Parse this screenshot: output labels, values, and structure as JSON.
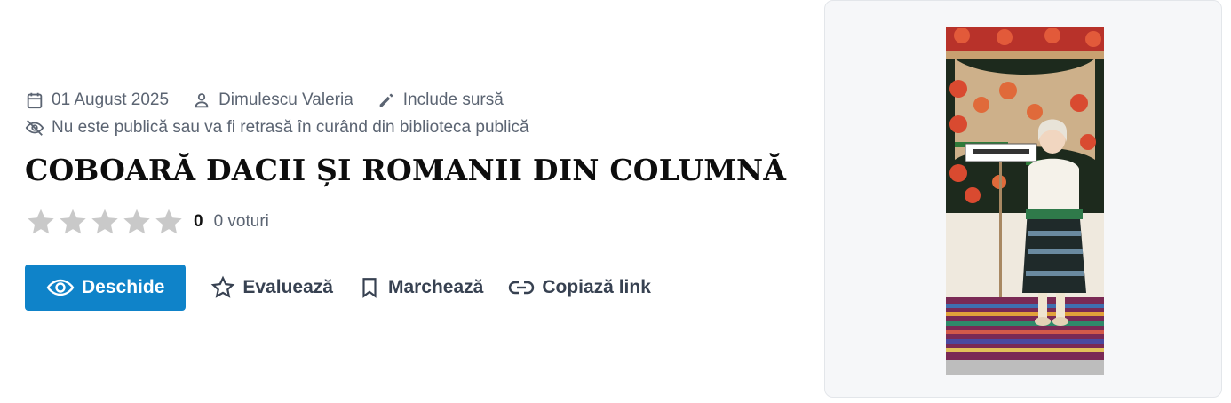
{
  "meta": {
    "date": "01 August 2025",
    "author": "Dimulescu Valeria",
    "source_note": "Include sursă",
    "visibility_note": "Nu este publică sau va fi retrasă în curând din biblioteca publică"
  },
  "title": "COBOARĂ DACII ȘI ROMANII DIN COLUMNĂ",
  "rating": {
    "score": "0",
    "votes": "0 voturi",
    "stars_filled": 0,
    "stars_total": 5
  },
  "actions": {
    "open": "Deschide",
    "rate": "Evaluează",
    "bookmark": "Marchează",
    "copy_link": "Copiază link"
  },
  "colors": {
    "primary": "#0f83c9",
    "muted": "#5b6472",
    "star_empty": "#c9c9c9"
  }
}
